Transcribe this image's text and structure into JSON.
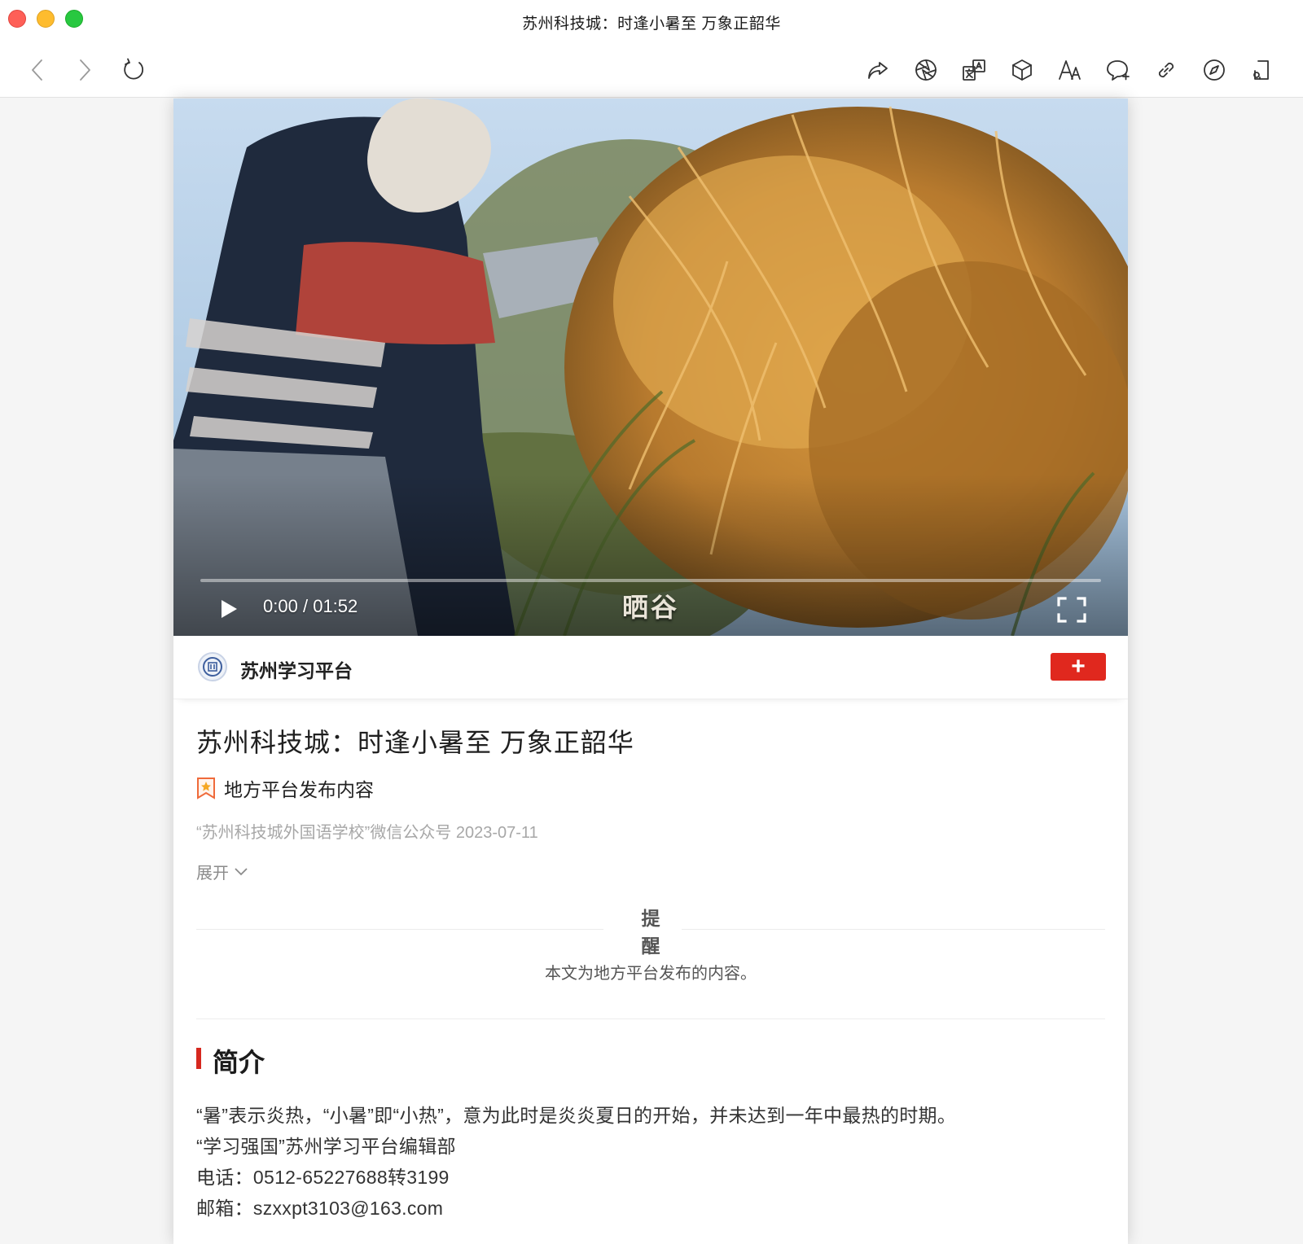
{
  "window": {
    "title": "苏州科技城：时逢小暑至 万象正韶华"
  },
  "toolbar": {
    "icons": [
      "share-icon",
      "aperture-icon",
      "translate-icon",
      "cube-icon",
      "font-size-icon",
      "comment-icon",
      "link-icon",
      "compass-icon",
      "device-icon"
    ]
  },
  "video": {
    "time_current": "0:00",
    "time_separator": "/",
    "time_total": "01:52",
    "subtitle": "晒谷",
    "progress": 0
  },
  "channel": {
    "name": "苏州学习平台",
    "subscribe_label": "+"
  },
  "article": {
    "title": "苏州科技城：时逢小暑至 万象正韶华",
    "badge": "地方平台发布内容",
    "meta": "“苏州科技城外国语学校”微信公众号 2023-07-11",
    "expand_label": "展开"
  },
  "notice": {
    "title_line1": "提",
    "title_line2": "醒",
    "body": "本文为地方平台发布的内容。"
  },
  "intro": {
    "section_title": "简介",
    "lines": [
      "“暑”表示炎热，“小暑”即“小热”，意为此时是炎炎夏日的开始，并未达到一年中最热的时期。",
      "“学习强国”苏州学习平台编辑部",
      "电话：0512-65227688转3199",
      "邮箱：szxxpt3103@163.com"
    ]
  },
  "colors": {
    "accent_red": "#e0281e",
    "section_bar": "#d6281f",
    "meta_gray": "#a7a7a7"
  }
}
